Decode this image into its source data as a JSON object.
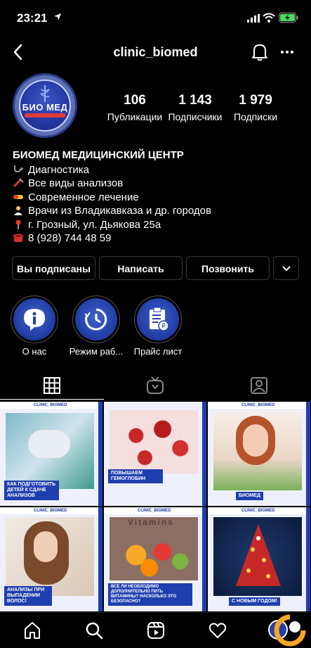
{
  "status": {
    "time": "23:21"
  },
  "header": {
    "username": "clinic_biomed"
  },
  "profile": {
    "avatar_text": "БИО МЕД",
    "stats": [
      {
        "value": "106",
        "label": "Публикации"
      },
      {
        "value": "1 143",
        "label": "Подписчики"
      },
      {
        "value": "1 979",
        "label": "Подписки"
      }
    ],
    "bio_name": "БИОМЕД МЕДИЦИНСКИЙ ЦЕНТР",
    "bio_lines": [
      {
        "icon": "stethoscope-icon",
        "text": "Диагностика"
      },
      {
        "icon": "syringe-icon",
        "text": "Все виды анализов"
      },
      {
        "icon": "pill-icon",
        "text": "Современное лечение"
      },
      {
        "icon": "doctor-icon",
        "text": "Врачи из Владикавказа и др. городов"
      },
      {
        "icon": "pin-icon",
        "text": "г. Грозный, ул. Дьякова 25а"
      },
      {
        "icon": "phone-icon",
        "text": "8 (928) 744 48 59"
      }
    ]
  },
  "actions": {
    "following": "Вы подписаны",
    "message": "Написать",
    "call": "Позвонить"
  },
  "highlights": [
    {
      "label": "О нас",
      "icon": "info-icon"
    },
    {
      "label": "Режим раб...",
      "icon": "clock-icon"
    },
    {
      "label": "Прайс лист",
      "icon": "price-list-icon"
    }
  ],
  "posts": [
    {
      "tag": "CLINIC_BIOMED",
      "caption": "КАК ПОДГОТОВИТЬ ДЕТЕЙ К СДАЧЕ АНАЛИЗОВ"
    },
    {
      "tag": "",
      "caption": "ПОВЫШАЕМ ГЕМОГЛОБИН"
    },
    {
      "tag": "CLINIC_BIOMED",
      "caption": "БИОМЕД"
    },
    {
      "tag": "CLINIC_BIOMED",
      "caption": "АНАЛИЗЫ ПРИ ВЫПАДЕНИИ ВОЛОС!"
    },
    {
      "tag": "CLINIC_BIOMED",
      "caption": "ВСЕ ЛИ НЕОБХОДИМО ДОПОЛНИТЕЛЬНО ПИТЬ ВИТАМИНЫ? НАСКОЛЬКО ЭТО БЕЗОПАСНО?"
    },
    {
      "tag": "CLINIC_BIOMED",
      "caption": "С НОВЫМ ГОДОМ!"
    }
  ],
  "posts_extra": {
    "vitamins_word": "Vitamins"
  },
  "colors": {
    "brand_blue": "#1f3fae",
    "background": "#000000",
    "battery_green": "#4cd964"
  }
}
